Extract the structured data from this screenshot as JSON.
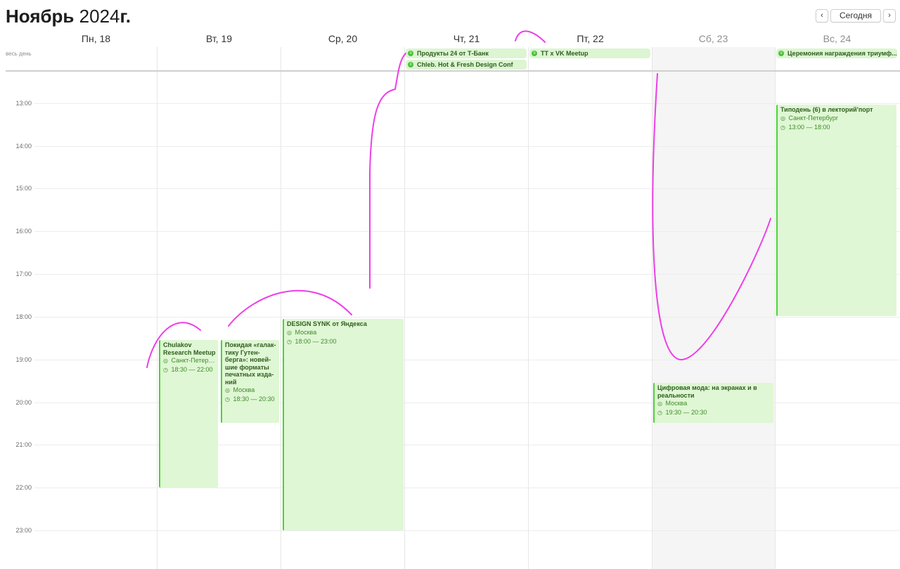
{
  "header": {
    "month": "Ноябрь",
    "year": "2024",
    "suffix": "г.",
    "prev_icon": "chevron-left-icon",
    "next_icon": "chevron-right-icon",
    "prev_glyph": "‹",
    "next_glyph": "›",
    "today_label": "Сегодня"
  },
  "days": [
    {
      "label": "Пн, 18"
    },
    {
      "label": "Вт, 19"
    },
    {
      "label": "Ср, 20"
    },
    {
      "label": "Чт, 21"
    },
    {
      "label": "Пт, 22"
    },
    {
      "label": "Сб, 23"
    },
    {
      "label": "Вс, 24"
    }
  ],
  "allday_label": "весь день",
  "hours": [
    "13:00",
    "14:00",
    "15:00",
    "16:00",
    "17:00",
    "18:00",
    "19:00",
    "20:00",
    "21:00",
    "22:00",
    "23:00"
  ],
  "allday_events": [
    {
      "title": "Продукты 24 от Т-Банк"
    },
    {
      "title": "Chleb. Hot & Fresh Design Conf"
    },
    {
      "title": "TT x VK Meetup"
    },
    {
      "title": "Церемония награждения триумф..."
    }
  ],
  "events": [
    {
      "title": "Chulakov Research Meetup",
      "location": "Санкт-Петерб...",
      "time": "18:30 — 22:00"
    },
    {
      "title": "Покидая «галак-тику Гутен-берга»: новей-шие форматы печатных изда-ний",
      "location": "Москва",
      "time": "18:30 — 20:30"
    },
    {
      "title": "DESIGN SYNK от Яндекса",
      "location": "Москва",
      "time": "18:00 — 23:00"
    },
    {
      "title": "Цифровая мода: на экранах и в реальности",
      "location": "Москва",
      "time": "19:30 — 20:30"
    },
    {
      "title": "Типодень (6) в лекторий'порт",
      "location": "Санкт-Петербург",
      "time": "13:00 — 18:00"
    }
  ],
  "icons": {
    "location": "pin-icon",
    "time": "clock-icon",
    "calendar": "calendar-icon"
  },
  "glyphs": {
    "location": "◎",
    "time": "◷",
    "calendar": "≡"
  },
  "colors": {
    "event_bg": "#dff7d4",
    "event_bar": "#4cd137",
    "event_text": "#2f5d1e",
    "ink": "#ee3ee9"
  }
}
